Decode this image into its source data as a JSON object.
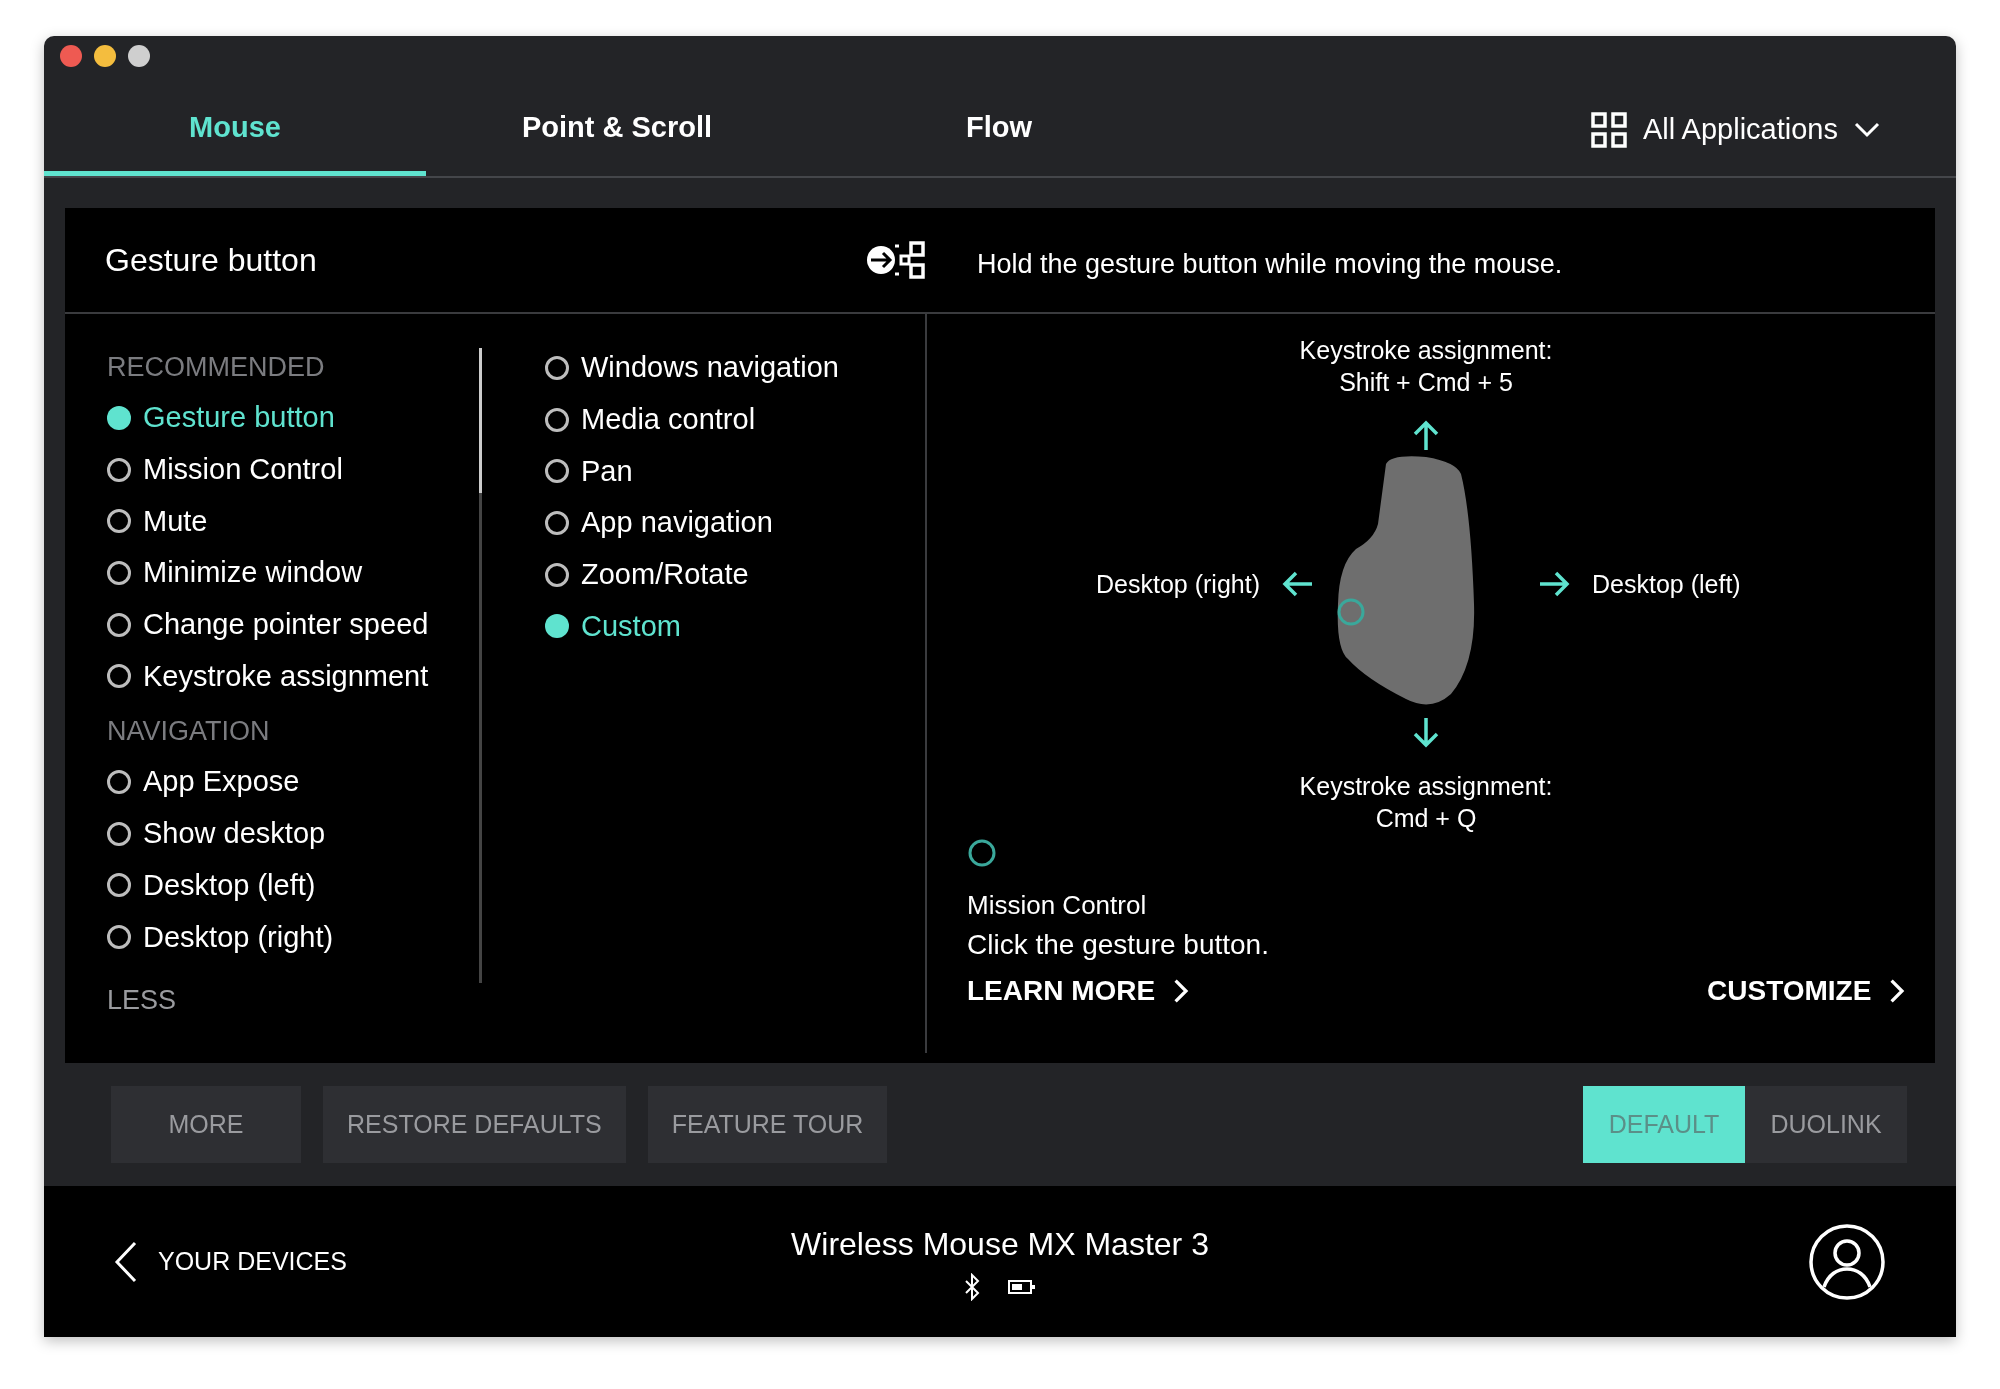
{
  "tabs": [
    {
      "label": "Mouse",
      "selected": true
    },
    {
      "label": "Point & Scroll",
      "selected": false
    },
    {
      "label": "Flow",
      "selected": false
    }
  ],
  "app_selector": {
    "label": "All Applications"
  },
  "panel": {
    "title": "Gesture button",
    "description": "Hold the gesture button while moving the mouse."
  },
  "action_list": {
    "sections": [
      {
        "heading": "RECOMMENDED",
        "items": [
          {
            "label": "Gesture button",
            "selected": true
          },
          {
            "label": "Mission Control",
            "selected": false
          },
          {
            "label": "Mute",
            "selected": false
          },
          {
            "label": "Minimize window",
            "selected": false
          },
          {
            "label": "Change pointer speed",
            "selected": false
          },
          {
            "label": "Keystroke assignment",
            "selected": false
          }
        ]
      },
      {
        "heading": "NAVIGATION",
        "items": [
          {
            "label": "App Expose",
            "selected": false
          },
          {
            "label": "Show desktop",
            "selected": false
          },
          {
            "label": "Desktop (left)",
            "selected": false
          },
          {
            "label": "Desktop (right)",
            "selected": false
          }
        ]
      }
    ],
    "less_label": "LESS",
    "more_items": [
      {
        "label": "Windows navigation",
        "selected": false
      },
      {
        "label": "Media control",
        "selected": false
      },
      {
        "label": "Pan",
        "selected": false
      },
      {
        "label": "App navigation",
        "selected": false
      },
      {
        "label": "Zoom/Rotate",
        "selected": false
      },
      {
        "label": "Custom",
        "selected": true
      }
    ]
  },
  "gestures": {
    "up": {
      "title": "Keystroke assignment:",
      "value": "Shift + Cmd + 5"
    },
    "left": {
      "title": "Desktop (right)"
    },
    "right": {
      "title": "Desktop (left)"
    },
    "down": {
      "title": "Keystroke assignment:",
      "value": "Cmd + Q"
    },
    "click": {
      "title": "Mission Control",
      "description": "Click the gesture button."
    }
  },
  "links": {
    "learn_more": "LEARN MORE",
    "customize": "CUSTOMIZE"
  },
  "buttons": [
    "MORE",
    "RESTORE DEFAULTS",
    "FEATURE TOUR"
  ],
  "modes": [
    {
      "label": "DEFAULT",
      "selected": true
    },
    {
      "label": "DUOLINK",
      "selected": false
    }
  ],
  "footer": {
    "back": "YOUR DEVICES",
    "device": "Wireless Mouse MX Master 3"
  }
}
